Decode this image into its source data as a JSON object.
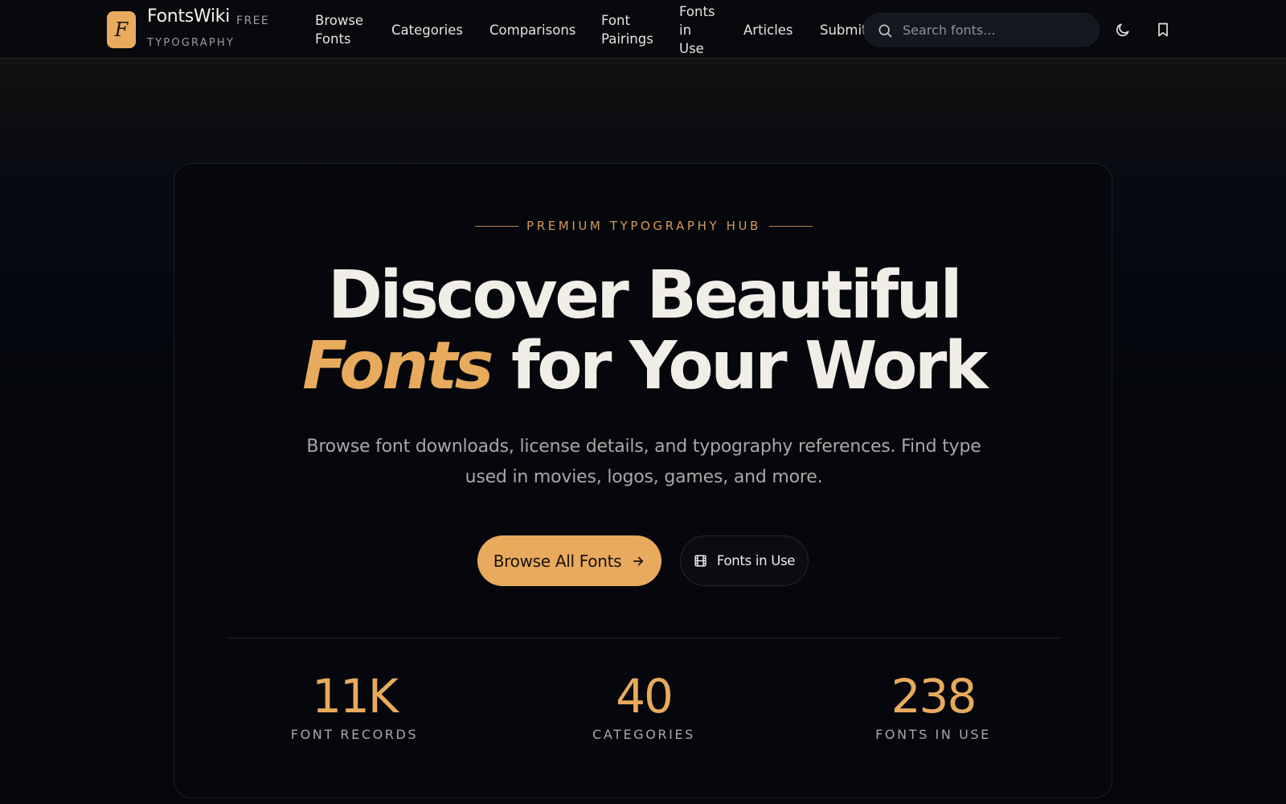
{
  "brand": {
    "logo_letter": "F",
    "name": "FontsWiki",
    "badge": "FREE",
    "tagline": "TYPOGRAPHY"
  },
  "nav": {
    "browse_fonts": {
      "line1": "Browse",
      "line2": "Fonts"
    },
    "categories": "Categories",
    "comparisons": "Comparisons",
    "font_pairings": {
      "line1": "Font",
      "line2": "Pairings"
    },
    "fonts_in_use": {
      "line1": "Fonts",
      "line2": "in",
      "line3": "Use"
    },
    "articles": "Articles",
    "submit": "Submit"
  },
  "search": {
    "placeholder": "Search fonts...",
    "value": "",
    "icon": "search-icon"
  },
  "header_icons": {
    "theme": "moon-icon",
    "bookmarks": "bookmark-icon"
  },
  "hero": {
    "eyebrow": "PREMIUM TYPOGRAPHY HUB",
    "headline_line1": "Discover Beautiful",
    "headline_accent": "Fonts",
    "headline_line2_rest": "for Your Work",
    "subcopy": "Browse font downloads, license details, and typography references. Find type used in movies, logos, games, and more.",
    "primary_button": "Browse All Fonts",
    "secondary_button": "Fonts in Use"
  },
  "stats": [
    {
      "value": "11K",
      "label": "FONT RECORDS"
    },
    {
      "value": "40",
      "label": "CATEGORIES"
    },
    {
      "value": "238",
      "label": "FONTS IN USE"
    }
  ],
  "colors": {
    "accent": "#e8aa5c",
    "background": "#05070c",
    "text": "#f1eee7",
    "muted": "#a9a8a6"
  }
}
